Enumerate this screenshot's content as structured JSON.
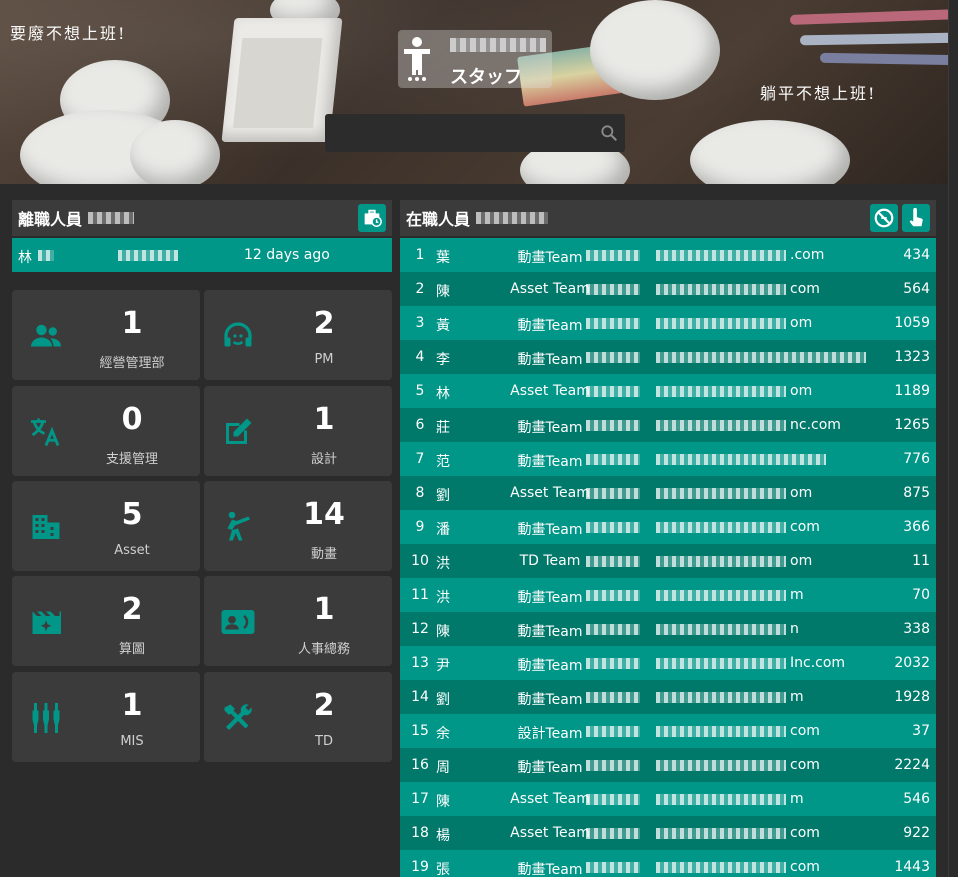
{
  "banner": {
    "handwriting_left": "要廢不想上班!",
    "handwriting_right": "躺平不想上班!",
    "brand_title": "スタッフ",
    "search": {
      "placeholder": "",
      "value": ""
    }
  },
  "left_panel": {
    "title": "離職人員",
    "resigned": {
      "name": "林",
      "time": "12 days ago"
    },
    "departments": [
      {
        "name": "經營管理部",
        "count": "1",
        "icon": "people-icon"
      },
      {
        "name": "PM",
        "count": "2",
        "icon": "headset-icon"
      },
      {
        "name": "支援管理",
        "count": "0",
        "icon": "translate-icon"
      },
      {
        "name": "設計",
        "count": "1",
        "icon": "edit-icon"
      },
      {
        "name": "Asset",
        "count": "5",
        "icon": "building-icon"
      },
      {
        "name": "動畫",
        "count": "14",
        "icon": "kick-icon"
      },
      {
        "name": "算圖",
        "count": "2",
        "icon": "movie-icon"
      },
      {
        "name": "人事總務",
        "count": "1",
        "icon": "contact-card-icon"
      },
      {
        "name": "MIS",
        "count": "1",
        "icon": "settings-input-icon"
      },
      {
        "name": "TD",
        "count": "2",
        "icon": "tools-icon"
      }
    ]
  },
  "right_panel": {
    "title": "在職人員",
    "staff": [
      {
        "idx": "1",
        "name": "葉",
        "team": "動畫Team",
        "mail": ".com",
        "num": "434"
      },
      {
        "idx": "2",
        "name": "陳",
        "team": "Asset Team",
        "mail": "com",
        "num": "564"
      },
      {
        "idx": "3",
        "name": "黃",
        "team": "動畫Team",
        "mail": "om",
        "num": "1059"
      },
      {
        "idx": "4",
        "name": "李",
        "team": "動畫Team",
        "mail": "",
        "num": "1323"
      },
      {
        "idx": "5",
        "name": "林",
        "team": "Asset Team",
        "mail": "om",
        "num": "1189"
      },
      {
        "idx": "6",
        "name": "莊",
        "team": "動畫Team",
        "mail": "nc.com",
        "num": "1265"
      },
      {
        "idx": "7",
        "name": "范",
        "team": "動畫Team",
        "mail": "",
        "num": "776"
      },
      {
        "idx": "8",
        "name": "劉",
        "team": "Asset Team",
        "mail": "om",
        "num": "875"
      },
      {
        "idx": "9",
        "name": "潘",
        "team": "動畫Team",
        "mail": "com",
        "num": "366"
      },
      {
        "idx": "10",
        "name": "洪",
        "team": "TD Team",
        "mail": "om",
        "num": "11"
      },
      {
        "idx": "11",
        "name": "洪",
        "team": "動畫Team",
        "mail": "m",
        "num": "70"
      },
      {
        "idx": "12",
        "name": "陳",
        "team": "動畫Team",
        "mail": "n",
        "num": "338"
      },
      {
        "idx": "13",
        "name": "尹",
        "team": "動畫Team",
        "mail": "Inc.com",
        "num": "2032"
      },
      {
        "idx": "14",
        "name": "劉",
        "team": "動畫Team",
        "mail": "m",
        "num": "1928"
      },
      {
        "idx": "15",
        "name": "余",
        "team": "設計Team",
        "mail": "com",
        "num": "37"
      },
      {
        "idx": "16",
        "name": "周",
        "team": "動畫Team",
        "mail": "com",
        "num": "2224"
      },
      {
        "idx": "17",
        "name": "陳",
        "team": "Asset Team",
        "mail": "m",
        "num": "546"
      },
      {
        "idx": "18",
        "name": "楊",
        "team": "Asset Team",
        "mail": "com",
        "num": "922"
      },
      {
        "idx": "19",
        "name": "張",
        "team": "動畫Team",
        "mail": "com",
        "num": "1443"
      }
    ]
  },
  "colors": {
    "accent": "#009688",
    "accent_dark": "#00796b",
    "panel": "#3b3b3b",
    "background": "#2b2b2b"
  }
}
